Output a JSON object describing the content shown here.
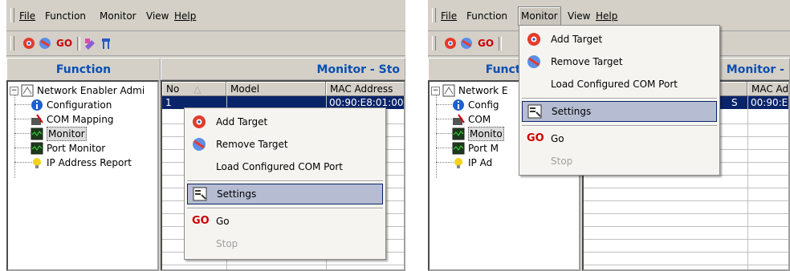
{
  "left": {
    "menu": [
      "File",
      "Function",
      "Monitor",
      "View",
      "Help"
    ],
    "function_header": "Function",
    "monitor_header": "Monitor - Sto",
    "tree": [
      "Network Enabler Admi",
      "Configuration",
      "COM Mapping",
      "Monitor",
      "Port Monitor",
      "IP Address Report"
    ],
    "columns": [
      "No",
      "Model",
      "MAC Address"
    ],
    "row": {
      "no": "1",
      "model": "",
      "mac": "00:90:E8:01:00"
    },
    "context_menu": [
      "Add Target",
      "Remove Target",
      "Load Configured COM Port",
      "Settings",
      "Go",
      "Stop"
    ],
    "go_icon": "GO"
  },
  "right": {
    "menu": [
      "File",
      "Function",
      "Monitor",
      "View",
      "Help"
    ],
    "function_header": "Functi",
    "monitor_header": "Monitor -",
    "tree": [
      "Network E",
      "Config",
      "COM",
      "Monito",
      "Port M",
      "IP Ad"
    ],
    "columns": [
      "",
      "MAC Ad"
    ],
    "row": {
      "cell": "S",
      "mac": "00:90:E"
    },
    "dropdown_menu": [
      "Add Target",
      "Remove Target",
      "Load Configured COM Port",
      "Settings",
      "Go",
      "Stop"
    ],
    "go_icon": "GO"
  },
  "colors": {
    "accent": "#0a4fb3",
    "selection": "#0a246a",
    "highlight": "#b6bdd2",
    "go": "#cc0000"
  }
}
